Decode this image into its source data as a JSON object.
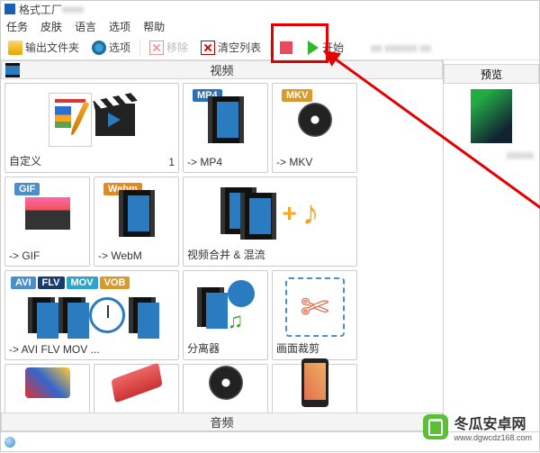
{
  "window": {
    "title": "格式工厂"
  },
  "menu": {
    "tasks": "任务",
    "skin": "皮肤",
    "language": "语言",
    "options": "选项",
    "help": "帮助"
  },
  "toolbar": {
    "output_folder": "输出文件夹",
    "options": "选项",
    "remove": "移除",
    "clear_list": "清空列表",
    "stop": "",
    "start": "开始"
  },
  "categories": {
    "video": "视频",
    "audio": "音频"
  },
  "preview": {
    "label": "预览"
  },
  "cells": {
    "custom": {
      "label": "自定义",
      "count": "1"
    },
    "mp4": {
      "label": "-> MP4",
      "badge": "MP4"
    },
    "mkv": {
      "label": "-> MKV",
      "badge": "MKV"
    },
    "gif": {
      "label": "-> GIF",
      "badge": "GIF"
    },
    "webm": {
      "label": "-> WebM",
      "badge": "Webm"
    },
    "merge": {
      "label": "视频合并 & 混流"
    },
    "multi": {
      "label": "-> AVI FLV MOV ...",
      "badges": [
        "AVI",
        "FLV",
        "MOV",
        "VOB"
      ]
    },
    "split": {
      "label": "分离器"
    },
    "crop": {
      "label": "画面裁剪"
    }
  },
  "watermark": {
    "text": "冬瓜安卓网",
    "url": "www.dgwcdz168.com"
  }
}
